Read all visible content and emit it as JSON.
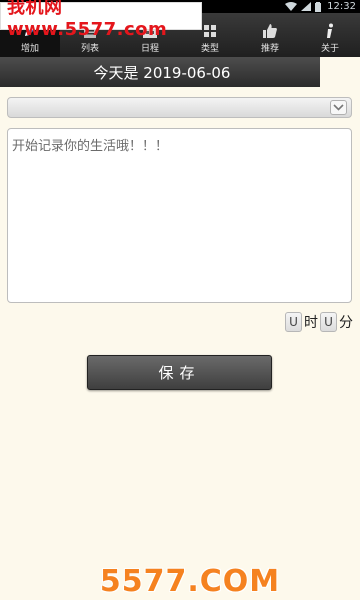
{
  "status_bar": {
    "time": "12:32"
  },
  "watermark_top": "我机网 www.5577.com",
  "tabs": [
    {
      "label": "增加",
      "icon": "pencil-icon",
      "active": true
    },
    {
      "label": "列表",
      "icon": "list-icon",
      "active": false
    },
    {
      "label": "日程",
      "icon": "calendar-icon",
      "active": false
    },
    {
      "label": "类型",
      "icon": "grid-icon",
      "active": false
    },
    {
      "label": "推荐",
      "icon": "thumbs-up-icon",
      "active": false
    },
    {
      "label": "关于",
      "icon": "info-icon",
      "active": false
    }
  ],
  "header": {
    "date_text": "今天是 2019-06-06"
  },
  "type_select": {
    "value": ""
  },
  "note": {
    "placeholder": "开始记录你的生活哦！！！"
  },
  "time": {
    "hour_value": "U",
    "hour_unit": "时",
    "minute_value": "U",
    "minute_unit": "分"
  },
  "save_label": "保存",
  "watermark_bottom": "5577.COM",
  "colors": {
    "accent_watermark_top": "#e4161c",
    "accent_watermark_bottom": "#f58220",
    "background": "#fdf9ec"
  }
}
